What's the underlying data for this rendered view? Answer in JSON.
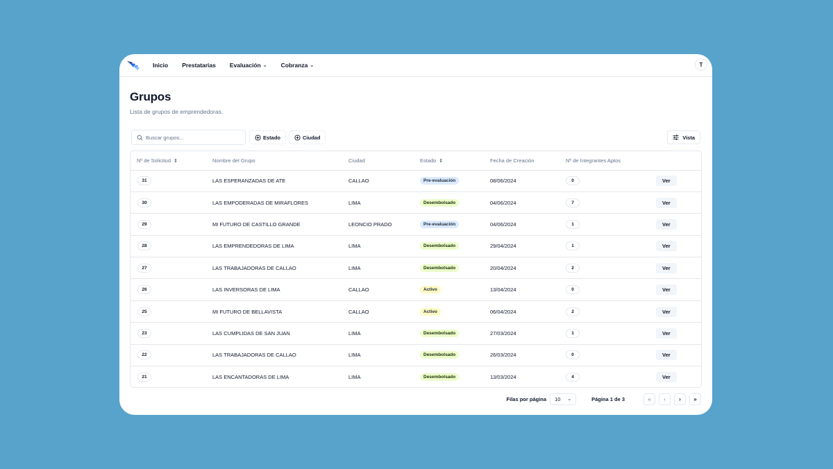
{
  "nav": {
    "items": [
      {
        "label": "Inicio",
        "dropdown": false
      },
      {
        "label": "Prestatarias",
        "dropdown": false
      },
      {
        "label": "Evaluación",
        "dropdown": true
      },
      {
        "label": "Cobranza",
        "dropdown": true
      }
    ],
    "avatar": "T"
  },
  "page": {
    "title": "Grupos",
    "subtitle": "Lista de grupos de emprendedoras."
  },
  "toolbar": {
    "search_placeholder": "Buscar grupos...",
    "filter_estado": "Estado",
    "filter_ciudad": "Ciudad",
    "vista": "Vista"
  },
  "table": {
    "headers": {
      "id": "Nº de Solicitud",
      "name": "Nombre del Grupo",
      "city": "Ciudad",
      "estado": "Estado",
      "fecha": "Fecha de Creación",
      "integrantes": "Nº de Integrantes Aptos"
    },
    "action_label": "Ver",
    "rows": [
      {
        "id": "31",
        "name": "LAS ESPERANZADAS DE ATE",
        "city": "CALLAO",
        "estado": "Pre-evaluación",
        "fecha": "08/06/2024",
        "integrantes": "0"
      },
      {
        "id": "30",
        "name": "LAS EMPODERADAS DE MIRAFLORES",
        "city": "LIMA",
        "estado": "Desembolsado",
        "fecha": "04/06/2024",
        "integrantes": "7"
      },
      {
        "id": "29",
        "name": "MI FUTURO DE CASTILLO GRANDE",
        "city": "LEONCIO PRADO",
        "estado": "Pre-evaluación",
        "fecha": "04/06/2024",
        "integrantes": "1"
      },
      {
        "id": "28",
        "name": "LAS EMPRENDEDORAS DE LIMA",
        "city": "LIMA",
        "estado": "Desembolsado",
        "fecha": "29/04/2024",
        "integrantes": "1"
      },
      {
        "id": "27",
        "name": "LAS TRABAJADORAS DE CALLAO",
        "city": "LIMA",
        "estado": "Desembolsado",
        "fecha": "20/04/2024",
        "integrantes": "2"
      },
      {
        "id": "26",
        "name": "LAS INVERSORAS DE LIMA",
        "city": "CALLAO",
        "estado": "Activo",
        "fecha": "13/04/2024",
        "integrantes": "0"
      },
      {
        "id": "25",
        "name": "MI FUTURO DE BELLAVISTA",
        "city": "CALLAO",
        "estado": "Activo",
        "fecha": "06/04/2024",
        "integrantes": "2"
      },
      {
        "id": "23",
        "name": "LAS CUMPLIDAS DE SAN JUAN",
        "city": "LIMA",
        "estado": "Desembolsado",
        "fecha": "27/03/2024",
        "integrantes": "1"
      },
      {
        "id": "22",
        "name": "LAS TRABAJADORAS DE CALLAO",
        "city": "LIMA",
        "estado": "Desembolsado",
        "fecha": "26/03/2024",
        "integrantes": "0"
      },
      {
        "id": "21",
        "name": "LAS ENCANTADORAS DE LIMA",
        "city": "LIMA",
        "estado": "Desembolsado",
        "fecha": "13/03/2024",
        "integrantes": "4"
      }
    ]
  },
  "pagination": {
    "rows_label": "Filas por página",
    "rows_value": "10",
    "page_info": "Página 1 de 3"
  },
  "status_colors": {
    "Pre-evaluación": "#dbeafe",
    "Desembolsado": "#ecfccb",
    "Activo": "#fef9c3"
  }
}
